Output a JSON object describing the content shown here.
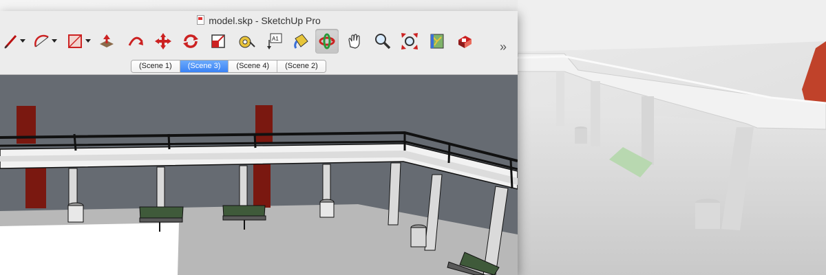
{
  "window": {
    "title": "model.skp - SketchUp Pro"
  },
  "toolbar": {
    "tools": [
      {
        "name": "pencil-icon",
        "has_dropdown": true
      },
      {
        "name": "arc-icon",
        "has_dropdown": true
      },
      {
        "name": "rectangle-icon",
        "has_dropdown": true
      },
      {
        "name": "push-pull-icon"
      },
      {
        "name": "follow-me-icon"
      },
      {
        "name": "move-icon"
      },
      {
        "name": "rotate-icon"
      },
      {
        "name": "scale-icon"
      },
      {
        "name": "tape-measure-icon"
      },
      {
        "name": "text-icon"
      },
      {
        "name": "paint-bucket-icon"
      },
      {
        "name": "orbit-icon",
        "active": true
      },
      {
        "name": "pan-icon"
      },
      {
        "name": "zoom-icon"
      },
      {
        "name": "zoom-extents-icon"
      },
      {
        "name": "add-location-icon"
      },
      {
        "name": "warehouse-icon"
      }
    ],
    "text_tool_label": "A1",
    "overflow_label": "»"
  },
  "scenes": {
    "tabs": [
      {
        "label": "(Scene 1)",
        "selected": false
      },
      {
        "label": "(Scene 3)",
        "selected": true
      },
      {
        "label": "(Scene 4)",
        "selected": false
      },
      {
        "label": "(Scene 2)",
        "selected": false
      }
    ]
  },
  "colors": {
    "selected_tab": "#3b83f5",
    "door_red": "#7a1810",
    "wall_gray": "#656b73",
    "bench_green": "#3f5a3a"
  }
}
